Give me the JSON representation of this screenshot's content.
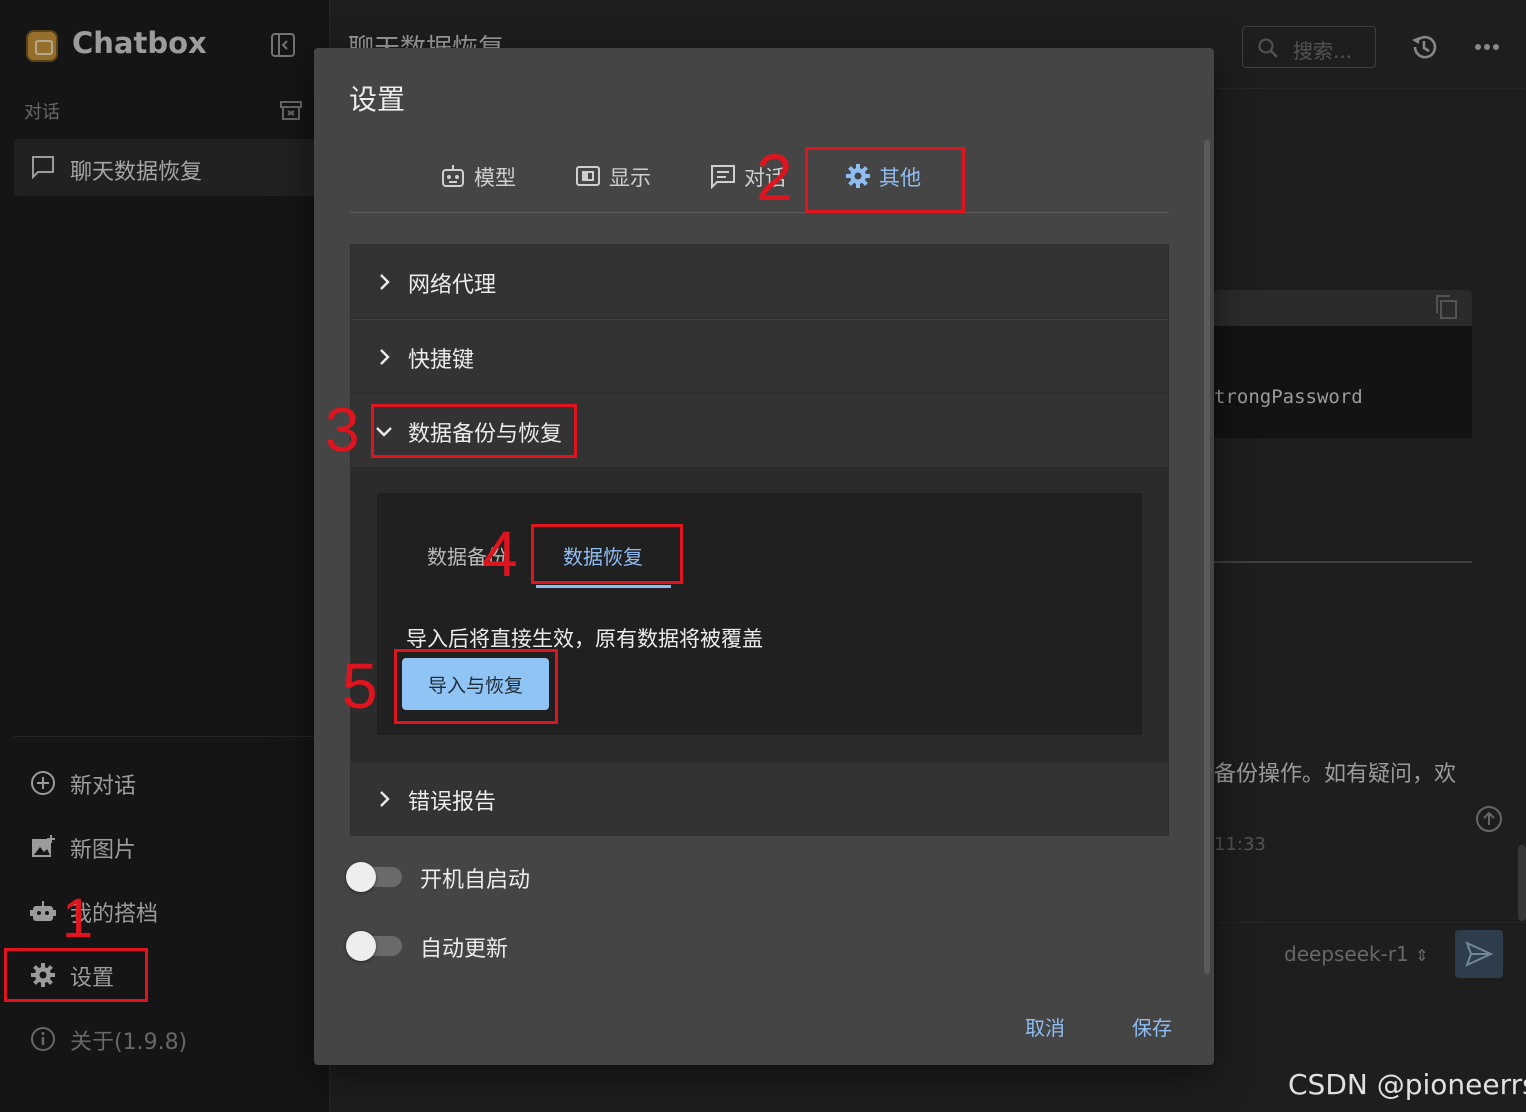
{
  "app": {
    "title": "Chatbox"
  },
  "sidebar": {
    "section_label": "对话",
    "conversation": "聊天数据恢复",
    "menu": [
      {
        "label": "新对话",
        "icon": "plus-circle-icon"
      },
      {
        "label": "新图片",
        "icon": "image-plus-icon"
      },
      {
        "label": "我的搭档",
        "icon": "robot-icon"
      },
      {
        "label": "设置",
        "icon": "gear-icon"
      },
      {
        "label": "关于(1.9.8)",
        "icon": "info-icon"
      }
    ]
  },
  "topbar": {
    "title": "聊天数据恢复",
    "search_placeholder": "搜索..."
  },
  "background": {
    "code_fragment": "trongPassword",
    "message_fragment": "备份操作。如有疑问，欢",
    "time_fragment": "11:33",
    "model": "deepseek-r1"
  },
  "dialog": {
    "title": "设置",
    "tabs": [
      {
        "label": "模型",
        "icon": "robot-icon"
      },
      {
        "label": "显示",
        "icon": "display-icon"
      },
      {
        "label": "对话",
        "icon": "chat-icon"
      },
      {
        "label": "其他",
        "icon": "gear-icon"
      }
    ],
    "active_tab": "其他",
    "sections": [
      {
        "label": "网络代理"
      },
      {
        "label": "快捷键"
      },
      {
        "label": "数据备份与恢复"
      },
      {
        "label": "错误报告"
      }
    ],
    "backup": {
      "subtabs": [
        "数据备份",
        "数据恢复"
      ],
      "active_subtab": "数据恢复",
      "note": "导入后将直接生效，原有数据将被覆盖",
      "import_button": "导入与恢复"
    },
    "toggles": [
      {
        "label": "开机自启动",
        "on": false
      },
      {
        "label": "自动更新",
        "on": false
      }
    ],
    "cancel": "取消",
    "save": "保存"
  },
  "annotations": [
    "1",
    "2",
    "3",
    "4",
    "5"
  ],
  "watermark": "CSDN @pioneerrs",
  "colors": {
    "accent": "#8fbdf2",
    "annotation": "#e0141e",
    "button": "#90c4f4"
  }
}
